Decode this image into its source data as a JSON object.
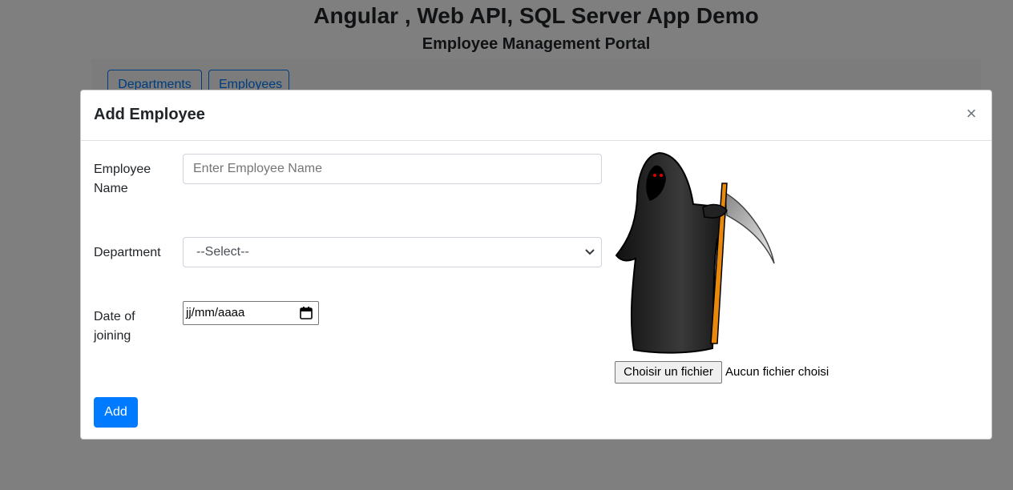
{
  "app": {
    "title": "Angular , Web API, SQL Server App Demo",
    "subtitle": "Employee Management Portal"
  },
  "nav": {
    "departments_label": "Departments",
    "employees_label": "Employees"
  },
  "modal": {
    "title": "Add Employee",
    "close_label": "×",
    "fields": {
      "name_label": "Employee Name",
      "name_placeholder": "Enter Employee Name",
      "name_value": "",
      "department_label": "Department",
      "department_selected": "--Select--",
      "date_label": "Date of joining",
      "date_placeholder": "jj/mm/aaaa"
    },
    "photo": {
      "choose_file_label": "Choisir un fichier",
      "no_file_text": "Aucun fichier choisi",
      "image_icon": "grim-reaper-image"
    },
    "add_label": "Add"
  },
  "colors": {
    "primary": "#007bff",
    "backdrop": "rgba(0,0,0,0.5)"
  }
}
